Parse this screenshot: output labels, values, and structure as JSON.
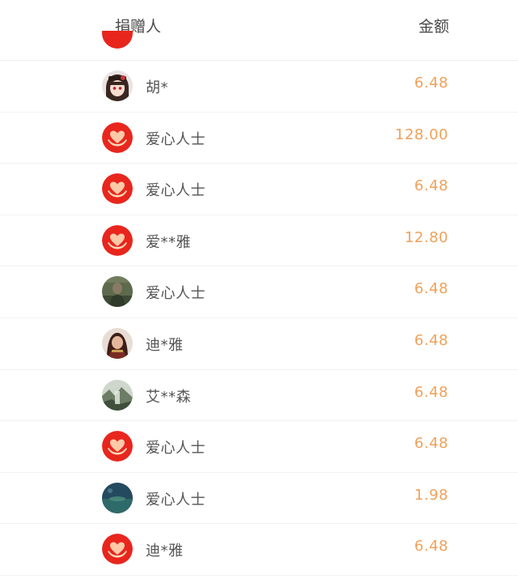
{
  "header": {
    "donor_label": "捐赠人",
    "amount_label": "金额"
  },
  "colors": {
    "amount": "#f0a15a",
    "heart_bg": "#e8261d"
  },
  "donations": [
    {
      "name": "胡*",
      "amount": "6.48",
      "avatar": "anime-girl-avatar"
    },
    {
      "name": "爱心人士",
      "amount": "128.00",
      "avatar": "heart-hands-icon"
    },
    {
      "name": "爱心人士",
      "amount": "6.48",
      "avatar": "heart-hands-icon"
    },
    {
      "name": "爱**雅",
      "amount": "12.80",
      "avatar": "heart-hands-icon"
    },
    {
      "name": "爱心人士",
      "amount": "6.48",
      "avatar": "photo-avatar"
    },
    {
      "name": "迪*雅",
      "amount": "6.48",
      "avatar": "warrior-avatar"
    },
    {
      "name": "艾**森",
      "amount": "6.48",
      "avatar": "landscape-avatar"
    },
    {
      "name": "爱心人士",
      "amount": "6.48",
      "avatar": "heart-hands-icon"
    },
    {
      "name": "爱心人士",
      "amount": "1.98",
      "avatar": "ocean-avatar"
    },
    {
      "name": "迪*雅",
      "amount": "6.48",
      "avatar": "heart-hands-icon"
    }
  ]
}
